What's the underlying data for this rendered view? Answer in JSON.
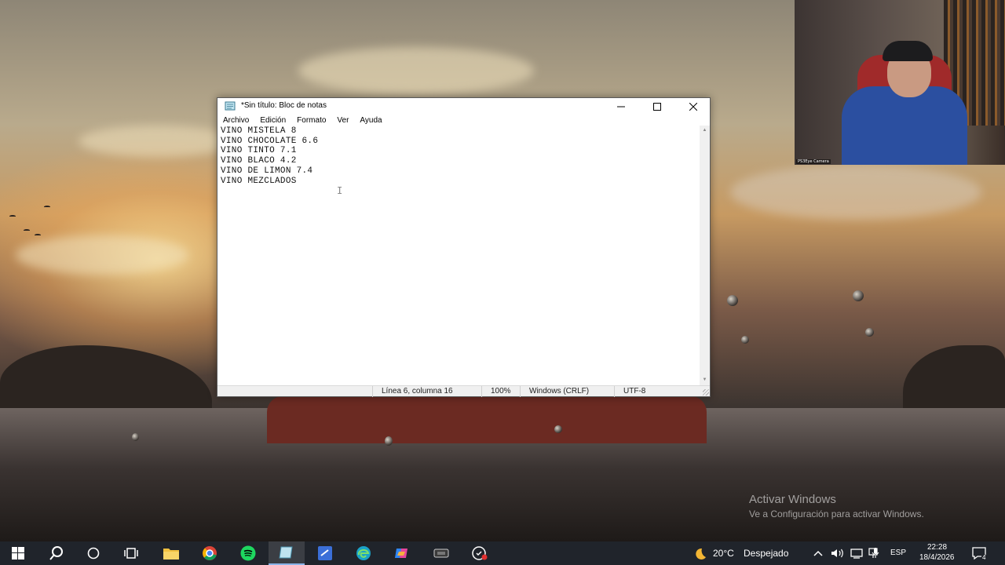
{
  "notepad": {
    "title": "*Sin título: Bloc de notas",
    "menu": [
      "Archivo",
      "Edición",
      "Formato",
      "Ver",
      "Ayuda"
    ],
    "lines": [
      "VINO MISTELA 8",
      "VINO CHOCOLATE 6.6",
      "VINO TINTO 7.1",
      "VINO BLACO 4.2",
      "VINO DE LIMON 7.4",
      "VINO MEZCLADOS"
    ],
    "status": {
      "position": "Línea 6, columna 16",
      "zoom": "100%",
      "line_ending": "Windows (CRLF)",
      "encoding": "UTF-8"
    }
  },
  "webcam": {
    "label": "PS3Eye Camera"
  },
  "watermark": {
    "title": "Activar Windows",
    "subtitle": "Ve a Configuración para activar Windows."
  },
  "taskbar": {
    "apps": [
      {
        "name": "start",
        "icon": "windows-logo-icon"
      },
      {
        "name": "search",
        "icon": "search-icon"
      },
      {
        "name": "cortana",
        "icon": "circle-icon"
      },
      {
        "name": "task-view",
        "icon": "task-view-icon"
      },
      {
        "name": "file-explorer",
        "icon": "folder-icon"
      },
      {
        "name": "chrome",
        "icon": "chrome-icon"
      },
      {
        "name": "spotify",
        "icon": "spotify-icon"
      },
      {
        "name": "notepad",
        "icon": "notepad-icon",
        "active": true
      },
      {
        "name": "app-blue",
        "icon": "blue-app-icon"
      },
      {
        "name": "edge",
        "icon": "edge-icon"
      },
      {
        "name": "copilot",
        "icon": "copilot-icon"
      },
      {
        "name": "app-dark",
        "icon": "dark-app-icon"
      },
      {
        "name": "app-record",
        "icon": "record-app-icon"
      }
    ],
    "weather": {
      "temp": "20°C",
      "condition": "Despejado",
      "icon": "moon-icon"
    },
    "language": "ESP",
    "time": "22:28",
    "date": "18/4/2026",
    "notifications": "4"
  },
  "colors": {
    "taskbar_bg": "#20242b",
    "active_indicator": "#8ab4e8",
    "spotify": "#1ed760",
    "edge": "#1aa3c8"
  }
}
